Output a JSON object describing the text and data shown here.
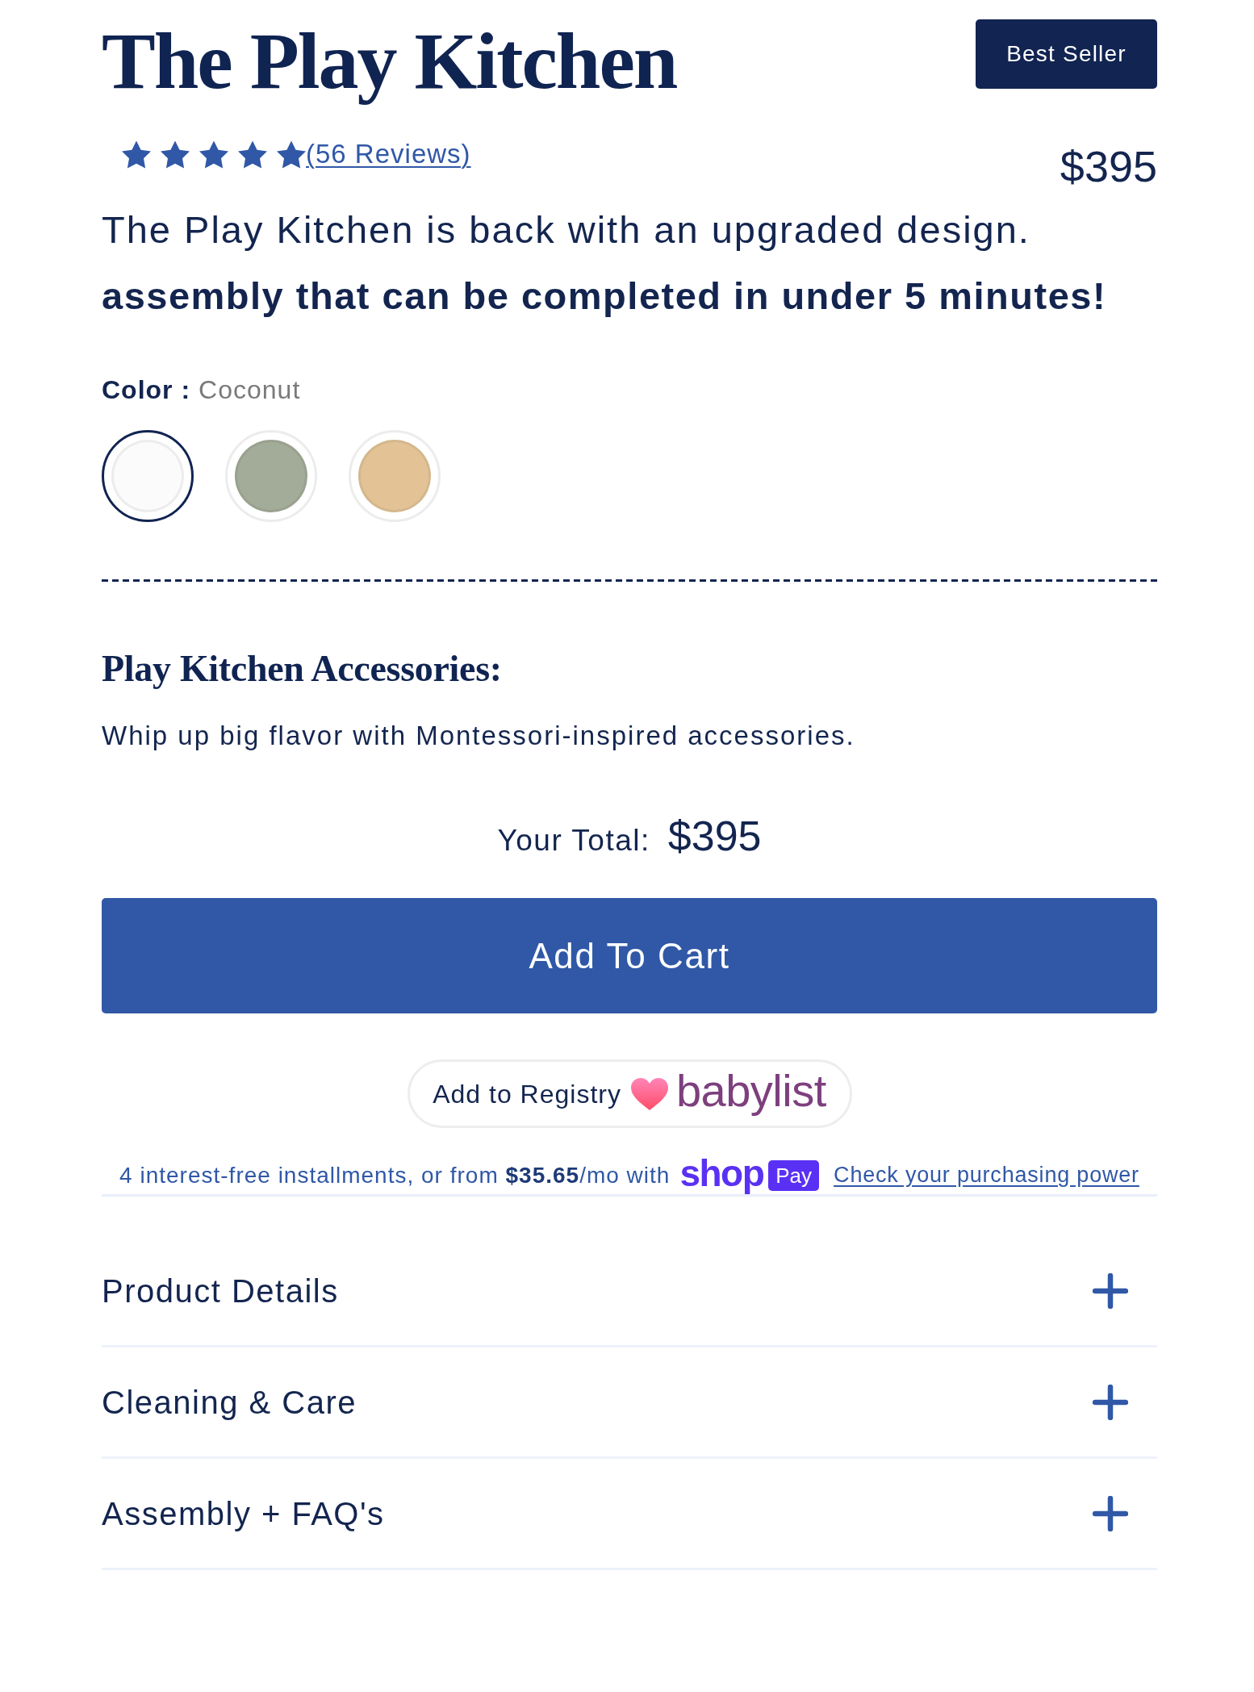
{
  "header": {
    "title": "The Play Kitchen",
    "badge": "Best Seller"
  },
  "rating": {
    "stars": 5,
    "reviews_link": "(56 Reviews)"
  },
  "price": "$395",
  "description": [
    {
      "text": "The Play Kitchen is back with an upgraded design.",
      "bold": false
    },
    {
      "text": "assembly that can be completed in under 5 minutes!",
      "bold": true
    }
  ],
  "color_picker": {
    "label": "Color :",
    "value": "Coconut",
    "swatches": [
      {
        "color": "#fbfbfb",
        "selected": true
      },
      {
        "color": "#a3ac98",
        "selected": false
      },
      {
        "color": "#e3c396",
        "selected": false
      }
    ]
  },
  "accessories": {
    "heading": "Play Kitchen Accessories:",
    "text": "Whip up big flavor with Montessori-inspired accessories."
  },
  "total": {
    "label": "Your Total:",
    "amount": "$395"
  },
  "add_to_cart": "Add To Cart",
  "registry_button": {
    "label": "Add to Registry",
    "logo_text": "babylist"
  },
  "installments": {
    "text": "4 interest-free installments, or from **$35.65**/mo with",
    "logo_text": "shop",
    "badge": "Pay",
    "link": "Check your purchasing power"
  },
  "accordion": [
    {
      "label": "Product Details",
      "expanded": false
    },
    {
      "label": "Cleaning & Care",
      "expanded": false
    },
    {
      "label": "Assembly + FAQ's",
      "expanded": false
    }
  ]
}
